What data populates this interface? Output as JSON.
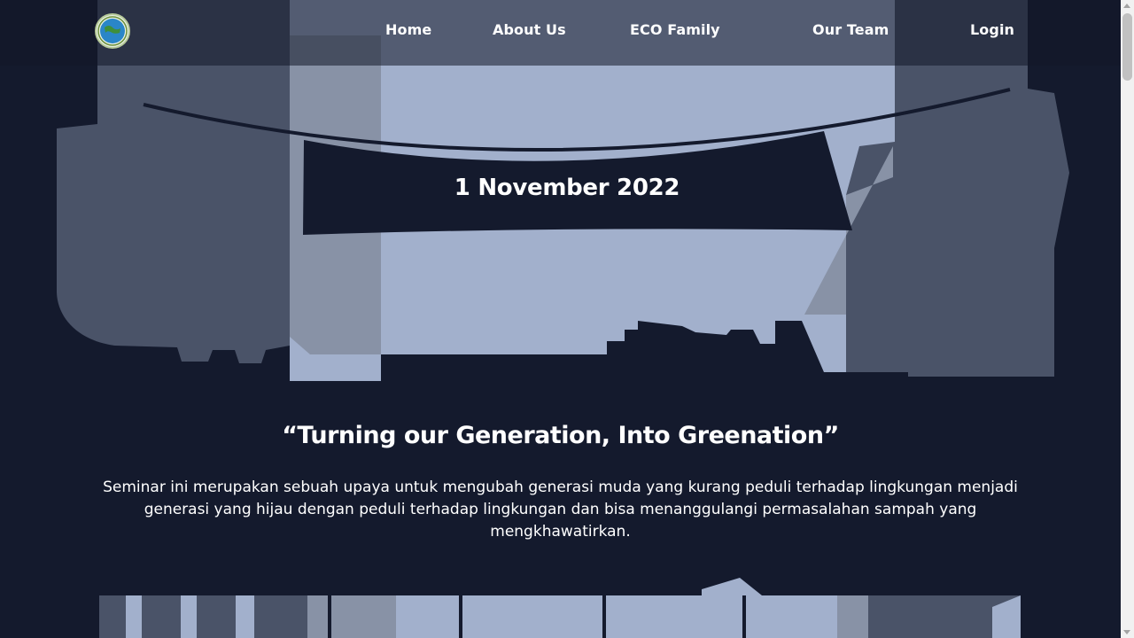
{
  "nav": {
    "logo_alt": "ECO logo",
    "links": [
      {
        "label": "Home"
      },
      {
        "label": "About Us"
      },
      {
        "label": "ECO Family"
      },
      {
        "label": "Our Team"
      },
      {
        "label": "Login"
      }
    ]
  },
  "hero": {
    "date": "1 November 2022"
  },
  "content": {
    "tagline": "“Turning our Generation, Into Greenation”",
    "description": "Seminar ini merupakan sebuah upaya untuk mengubah generasi muda yang kurang peduli terhadap lingkungan menjadi generasi yang hijau dengan peduli terhadap lingkungan dan bisa menanggulangi permasalahan sampah yang mengkhawatirkan."
  },
  "colors": {
    "background": "#141a2d",
    "sky": "#a2b0cc",
    "building_dark": "#4a5368",
    "building_mid": "#8892a6",
    "text": "#ffffff"
  },
  "icons": {
    "logo": "globe-emblem-icon"
  }
}
